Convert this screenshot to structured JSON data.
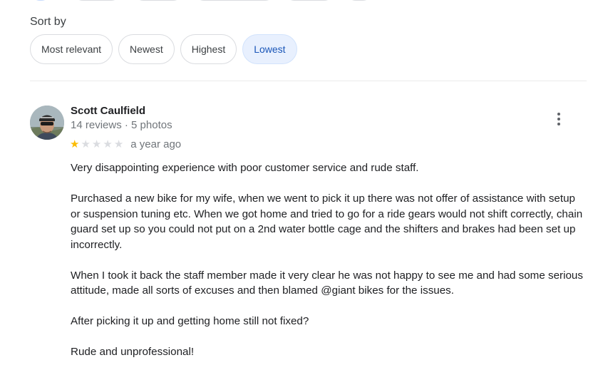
{
  "filters": {
    "sort_label": "Sort by",
    "options": [
      "Most relevant",
      "Newest",
      "Highest",
      "Lowest"
    ],
    "selected": "Lowest"
  },
  "review": {
    "reviewer_name": "Scott Caulfield",
    "reviewer_meta": "14 reviews · 5 photos",
    "rating": 1,
    "max_rating": 5,
    "time": "a year ago",
    "paragraphs": [
      "Very disappointing experience with poor customer service and rude staff.",
      "Purchased a new bike for my wife, when we went to pick it up there was not offer of assistance with setup or suspension tuning etc. When we got home and tried to go for a ride gears would not shift correctly, chain guard set up so you could not put on a 2nd water bottle cage and the shifters and brakes had been set up incorrectly.",
      "When I took it back the staff member made it very clear he was not happy to see me and had some serious attitude, made all sorts of excuses and then blamed @giant bikes for the issues.",
      "After picking it up and getting home still not fixed?",
      "Rude and unprofessional!"
    ],
    "more_icon": "more-vert-icon"
  },
  "colors": {
    "selected_chip_bg": "#e8f0fe",
    "selected_chip_text": "#1a56b8",
    "star_filled": "#fbbc04",
    "star_empty": "#dadce0"
  }
}
